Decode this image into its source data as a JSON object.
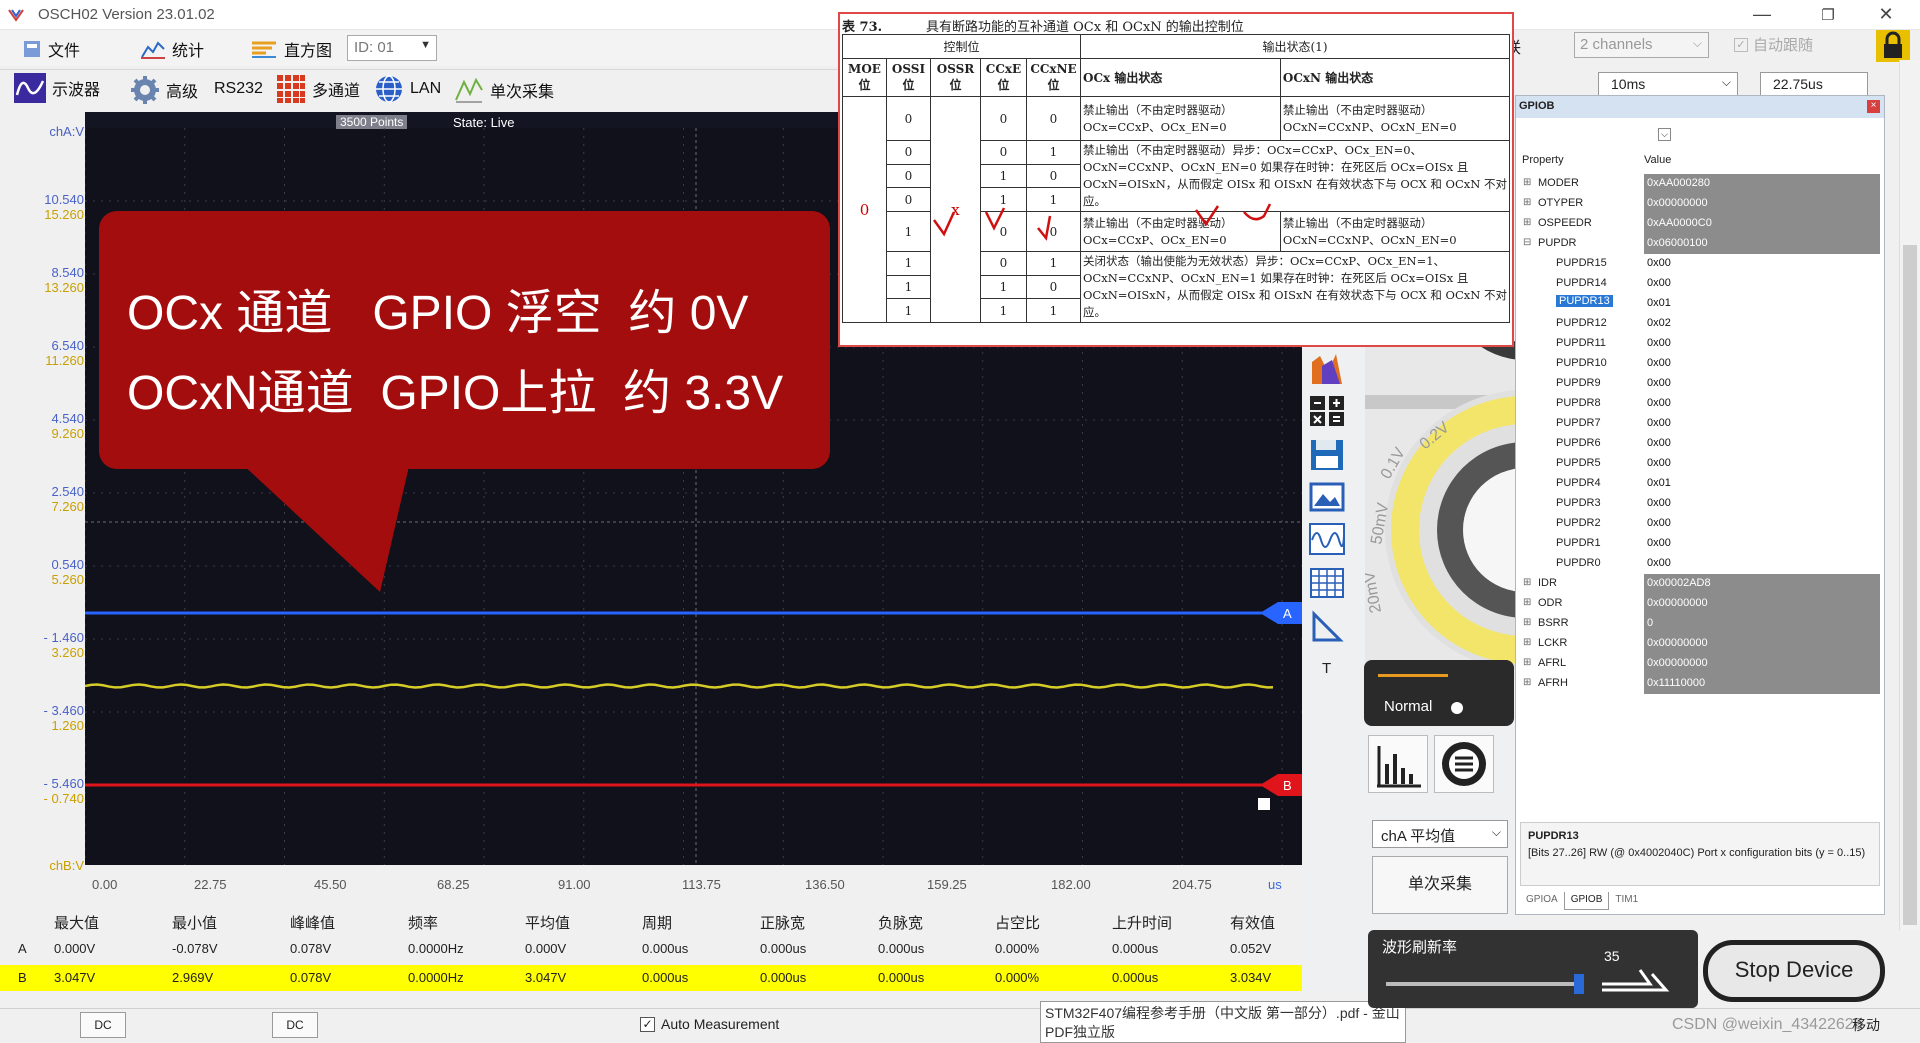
{
  "window": {
    "title": "OSCH02  Version 23.01.02"
  },
  "toolbar1": {
    "file": "文件",
    "stats": "统计",
    "histogram": "直方图",
    "id_value": "ID: 01",
    "link": "联",
    "channels": "2 channels",
    "autofollow": "自动跟随",
    "time_div": "10ms",
    "cursor_time": "22.75us"
  },
  "toolbar2": {
    "scope": "示波器",
    "advanced": "高级",
    "rs232": "RS232",
    "multichannel": "多通道",
    "lan": "LAN",
    "single": "单次采集"
  },
  "scope": {
    "points": "3500 Points",
    "state": "State: Live",
    "cha_label": "chA:V",
    "chb_label": "chB:V",
    "x_unit": "us",
    "ya": [
      "10.540",
      "8.540",
      "6.540",
      "4.540",
      "2.540",
      "0.540",
      "- 1.460",
      "- 3.460",
      "- 5.460"
    ],
    "yb": [
      "15.260",
      "13.260",
      "11.260",
      "9.260",
      "7.260",
      "5.260",
      "3.260",
      "1.260",
      "- 0.740"
    ],
    "x": [
      "0.00",
      "22.75",
      "45.50",
      "68.25",
      "91.00",
      "113.75",
      "136.50",
      "159.25",
      "182.00",
      "204.75"
    ],
    "marker_a": "A",
    "marker_b": "B",
    "colors": {
      "cha": "#2864ff",
      "yellow": "#d6cc28",
      "red": "#e0141b"
    }
  },
  "callout": {
    "line1": "OCx 通道   GPIO 浮空  约 0V",
    "line2": "OCxN通道  GPIO上拉  约 3.3V"
  },
  "measure": {
    "headers": [
      "最大值",
      "最小值",
      "峰峰值",
      "频率",
      "平均值",
      "周期",
      "正脉宽",
      "负脉宽",
      "占空比",
      "上升时间",
      "有效值"
    ],
    "rowA": {
      "label": "A",
      "values": [
        "0.000V",
        "-0.078V",
        "0.078V",
        "0.0000Hz",
        "0.000V",
        "0.000us",
        "0.000us",
        "0.000us",
        "0.000%",
        "0.000us",
        "0.052V"
      ]
    },
    "rowB": {
      "label": "B",
      "values": [
        "3.047V",
        "2.969V",
        "0.078V",
        "0.0000Hz",
        "3.047V",
        "0.000us",
        "0.000us",
        "0.000us",
        "0.000%",
        "0.000us",
        "3.034V"
      ]
    }
  },
  "bottom": {
    "dc1": "DC",
    "dc2": "DC",
    "auto_measure": "Auto Measurement",
    "pdf_tooltip": "STM32F407编程参考手册（中文版 第一部分）.pdf - 金山PDF独立版",
    "watermark": "CSDN @weixin_43422626"
  },
  "pdf": {
    "caption_num": "表 73.",
    "caption": "具有断路功能的互补通道 OCx 和 OCxN 的输出控制位",
    "ctrl_header": "控制位",
    "out_header": "输出状态(1)",
    "cols": {
      "moe": "MOE 位",
      "ossi": "OSSI 位",
      "ossr": "OSSR 位",
      "ccxe": "CCxE 位",
      "ccxne": "CCxNE 位",
      "ocx": "OCx 输出状态",
      "ocxn": "OCxN 输出状态"
    },
    "vals": {
      "r1": [
        "0",
        "0",
        "0"
      ],
      "r2": [
        "0",
        "0",
        "1"
      ],
      "r3": [
        "0",
        "1",
        "0"
      ],
      "r4": [
        "0",
        "1",
        "1"
      ],
      "r5": [
        "1",
        "0",
        "0"
      ],
      "r6": [
        "1",
        "0",
        "1"
      ],
      "r7": [
        "1",
        "1",
        "0"
      ],
      "r8": [
        "1",
        "1",
        "1"
      ]
    },
    "desc1a": "禁止输出（不由定时器驱动）OCx=CCxP、OCx_EN=0",
    "desc1b": "禁止输出（不由定时器驱动）OCxN=CCxNP、OCxN_EN=0",
    "desc2": "禁止输出（不由定时器驱动）异步：OCx=CCxP、OCx_EN=0、OCxN=CCxNP、OCxN_EN=0 如果存在时钟：在死区后 OCx=OISx 且 OCxN=OISxN，从而假定 OISx 和 OISxN 在有效状态下与 OCX 和 OCxN 不对应。",
    "desc3a": "禁止输出（不由定时器驱动）OCx=CCxP、OCx_EN=0",
    "desc3b": "禁止输出（不由定时器驱动）OCxN=CCxNP、OCxN_EN=0",
    "desc4": "关闭状态（输出使能为无效状态）异步：OCx=CCxP、OCx_EN=1、OCxN=CCxNP、OCxN_EN=1 如果存在时钟：在死区后 OCx=OISx 且 OCxN=OISxN，从而假定 OISx 和 OISxN 在有效状态下与 OCX 和 OCxN 不对应。",
    "moe_mark": "0",
    "ossr_mark": "x"
  },
  "gpio": {
    "title": "GPIOB",
    "col_prop": "Property",
    "col_val": "Value",
    "rows": [
      {
        "n": "MODER",
        "v": "0xAA000280",
        "g": 1
      },
      {
        "n": "OTYPER",
        "v": "0x00000000",
        "g": 1
      },
      {
        "n": "OSPEEDR",
        "v": "0xAA0000C0",
        "g": 1
      },
      {
        "n": "PUPDR",
        "v": "0x06000100",
        "g": 1
      },
      {
        "n": "PUPDR15",
        "v": "0x00"
      },
      {
        "n": "PUPDR14",
        "v": "0x00"
      },
      {
        "n": "PUPDR13",
        "v": "0x01",
        "sel": 1
      },
      {
        "n": "PUPDR12",
        "v": "0x02"
      },
      {
        "n": "PUPDR11",
        "v": "0x00"
      },
      {
        "n": "PUPDR10",
        "v": "0x00"
      },
      {
        "n": "PUPDR9",
        "v": "0x00"
      },
      {
        "n": "PUPDR8",
        "v": "0x00"
      },
      {
        "n": "PUPDR7",
        "v": "0x00"
      },
      {
        "n": "PUPDR6",
        "v": "0x00"
      },
      {
        "n": "PUPDR5",
        "v": "0x00"
      },
      {
        "n": "PUPDR4",
        "v": "0x01"
      },
      {
        "n": "PUPDR3",
        "v": "0x00"
      },
      {
        "n": "PUPDR2",
        "v": "0x00"
      },
      {
        "n": "PUPDR1",
        "v": "0x00"
      },
      {
        "n": "PUPDR0",
        "v": "0x00"
      },
      {
        "n": "IDR",
        "v": "0x00002AD8",
        "g": 1
      },
      {
        "n": "ODR",
        "v": "0x00000000",
        "g": 1
      },
      {
        "n": "BSRR",
        "v": "0",
        "g": 1
      },
      {
        "n": "LCKR",
        "v": "0x00000000",
        "g": 1
      },
      {
        "n": "AFRL",
        "v": "0x00000000",
        "g": 1
      },
      {
        "n": "AFRH",
        "v": "0x11110000",
        "g": 1
      }
    ],
    "detail_title": "PUPDR13",
    "detail_text": "[Bits 27..26] RW (@ 0x4002040C) Port x configuration bits (y = 0..15)",
    "tabs": [
      "GPIOA",
      "GPIOB",
      "TIM1"
    ]
  },
  "right": {
    "normal": "Normal",
    "cha_avg": "chA 平均值",
    "single_btn": "单次采集",
    "refresh": "波形刷新率",
    "refresh_val": "35",
    "stop": "Stop Device",
    "knob_labels": [
      "0.2V",
      "0.1V",
      "50mV",
      "20mV"
    ],
    "t_label": "T",
    "bottom_right": "移动"
  }
}
